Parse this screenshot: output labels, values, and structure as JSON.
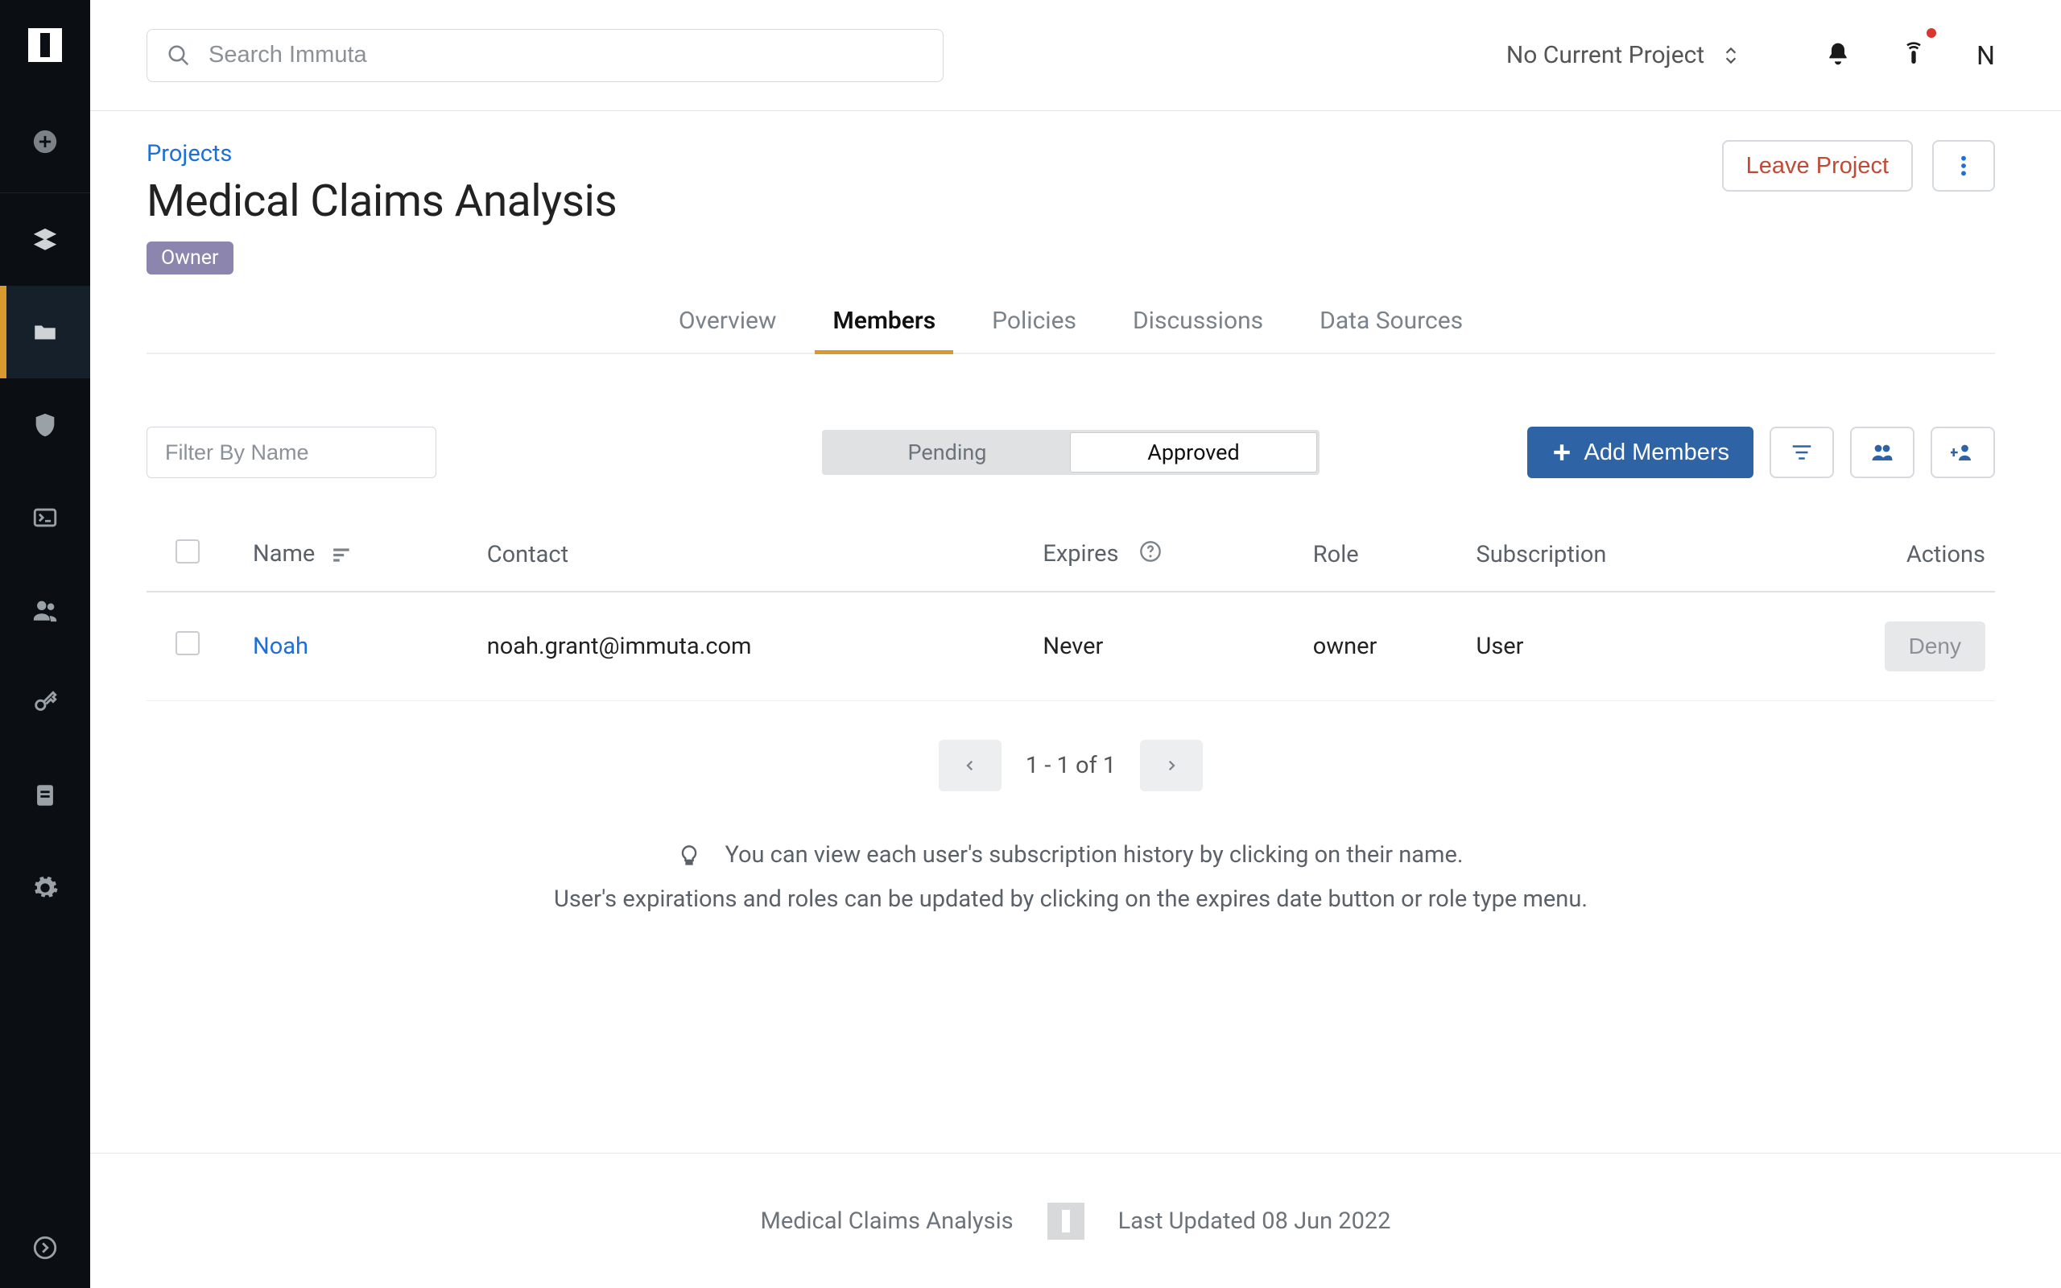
{
  "search": {
    "placeholder": "Search Immuta"
  },
  "topbar": {
    "project_label": "No Current Project",
    "avatar_initial": "N"
  },
  "breadcrumb": "Projects",
  "title": "Medical Claims Analysis",
  "role_badge": "Owner",
  "header_actions": {
    "leave_label": "Leave Project"
  },
  "tabs": [
    {
      "label": "Overview"
    },
    {
      "label": "Members",
      "active": true
    },
    {
      "label": "Policies"
    },
    {
      "label": "Discussions"
    },
    {
      "label": "Data Sources"
    }
  ],
  "filter": {
    "placeholder": "Filter By Name"
  },
  "segmented": {
    "pending_label": "Pending",
    "approved_label": "Approved"
  },
  "toolbar": {
    "add_members_label": "Add Members"
  },
  "table": {
    "columns": {
      "name": "Name",
      "contact": "Contact",
      "expires": "Expires",
      "role": "Role",
      "subscription": "Subscription",
      "actions": "Actions"
    },
    "rows": [
      {
        "name": "Noah",
        "contact": "noah.grant@immuta.com",
        "expires": "Never",
        "role": "owner",
        "subscription": "User",
        "action_label": "Deny"
      }
    ]
  },
  "pagination": {
    "status": "1 - 1 of 1"
  },
  "hints": {
    "line1": "You can view each user's subscription history by clicking on their name.",
    "line2": "User's expirations and roles can be updated by clicking on the expires date button or role type menu."
  },
  "footer": {
    "project_name": "Medical Claims Analysis",
    "updated": "Last Updated 08 Jun 2022"
  }
}
